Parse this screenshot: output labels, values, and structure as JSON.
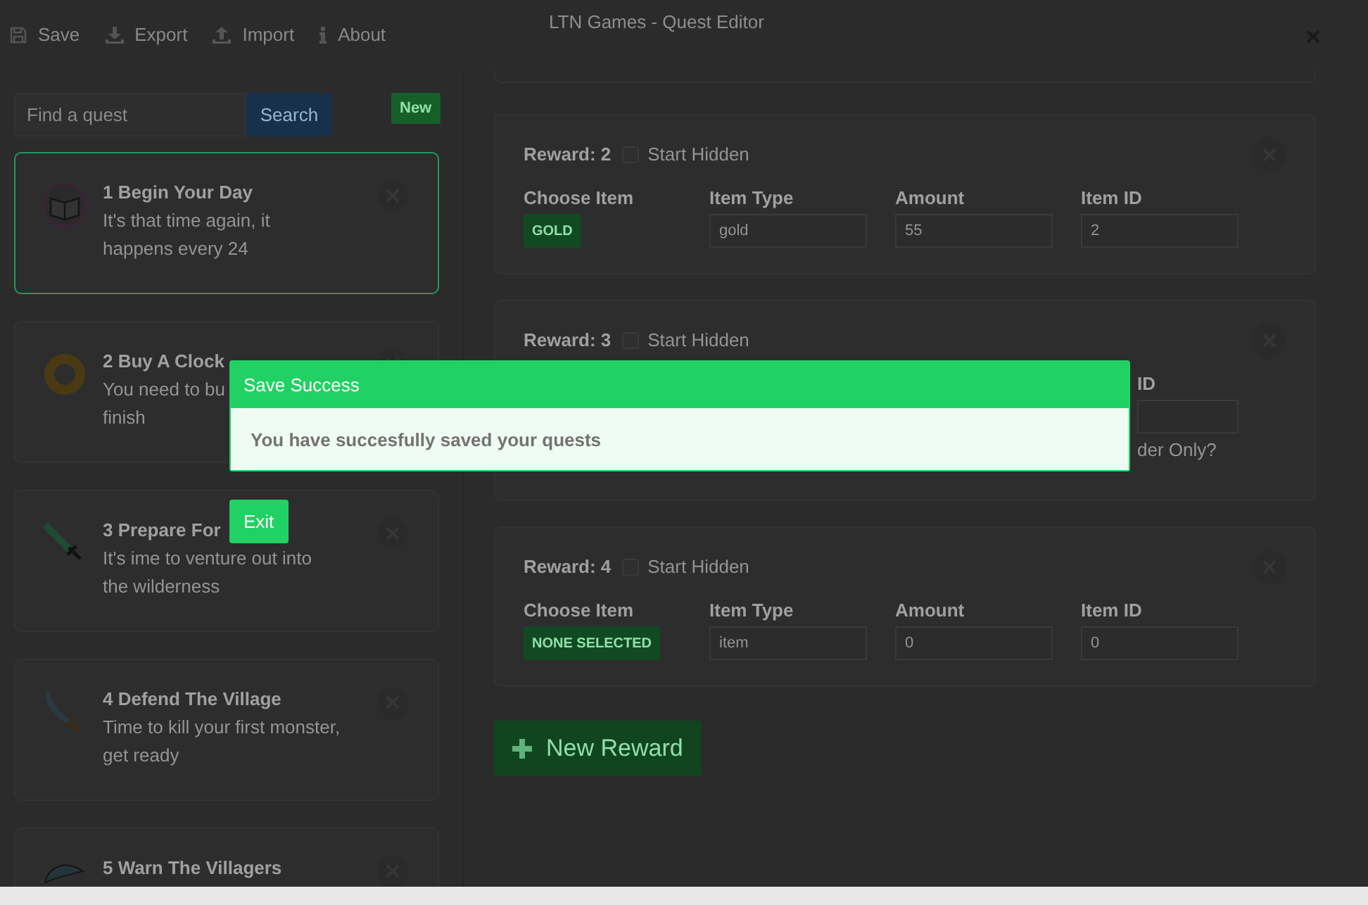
{
  "window": {
    "title": "LTN Games - Quest Editor"
  },
  "toolbar": [
    {
      "label": "Save",
      "kind": "save"
    },
    {
      "label": "Export",
      "kind": "export"
    },
    {
      "label": "Import",
      "kind": "import"
    },
    {
      "label": "About",
      "kind": "about"
    }
  ],
  "sidebar": {
    "search": {
      "placeholder": "Find a quest"
    },
    "search_button": "Search",
    "new_button": "New",
    "quests": [
      {
        "title": "1 Begin Your Day",
        "lines": [
          "It's that time again, it",
          "happens every 24"
        ],
        "kind": "book",
        "selected": true
      },
      {
        "title": "2 Buy A Clock",
        "lines": [
          "You need to bu",
          "finish"
        ],
        "kind": "ring",
        "selected": false
      },
      {
        "title": "3 Prepare For",
        "lines": [
          "It's ime to venture out into",
          "the wilderness"
        ],
        "kind": "green-sword",
        "selected": false
      },
      {
        "title": "4 Defend The Village",
        "lines": [
          "Time to kill your first monster,",
          "get ready"
        ],
        "kind": "sword",
        "selected": false
      },
      {
        "title": "5 Warn The Villagers",
        "kind": "feather",
        "selected": false
      }
    ]
  },
  "rewards": [
    {
      "kind": "full",
      "label": "Reward: 2",
      "start_hidden": {
        "label": "Start Hidden",
        "checked": false
      },
      "columns": [
        "Choose Item",
        "Item Type",
        "Amount",
        "Item ID"
      ],
      "choice": "GOLD",
      "item_type": "gold",
      "amount": "55",
      "item_id": "2"
    },
    {
      "kind": "covered",
      "label": "Reward: 3",
      "start_hidden": {
        "label": "Start Hidden",
        "checked": false
      },
      "visible_label": "ID",
      "visible_note": "der Only?"
    },
    {
      "kind": "full",
      "label": "Reward: 4",
      "start_hidden": {
        "label": "Start Hidden",
        "checked": false
      },
      "columns": [
        "Choose Item",
        "Item Type",
        "Amount",
        "Item ID"
      ],
      "choice": "NONE SELECTED",
      "item_type": "item",
      "amount": "0",
      "item_id": "0"
    }
  ],
  "new_reward_button": "New Reward",
  "modal": {
    "title": "Save Success",
    "message": "You have succesfully saved your quests",
    "exit_button": "Exit"
  }
}
